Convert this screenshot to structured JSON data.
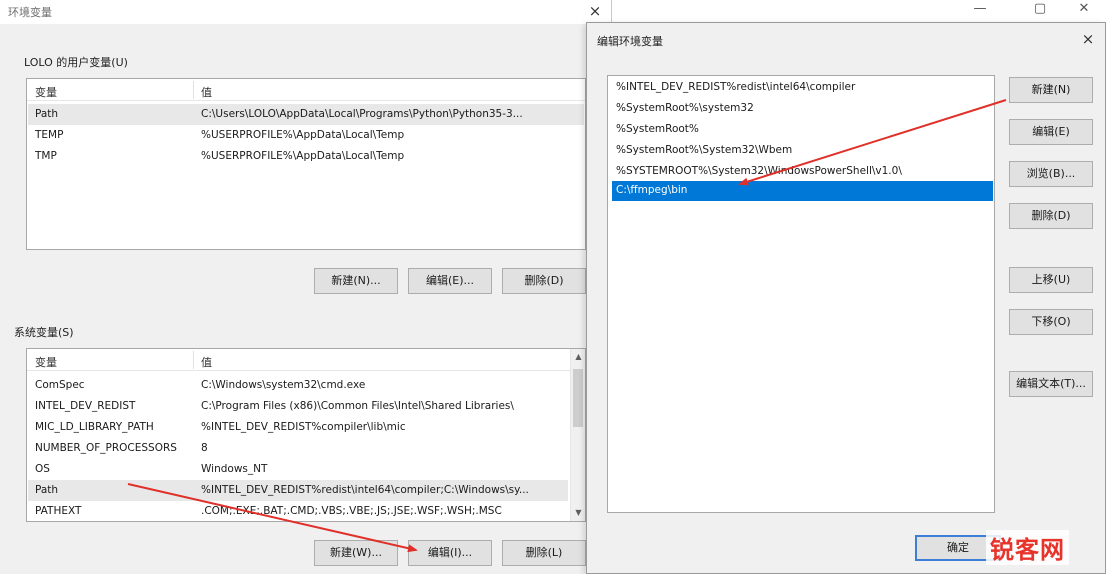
{
  "env_window": {
    "title": "环境变量",
    "close_glyph": "×",
    "user_group_label": "LOLO 的用户变量(U)",
    "user_columns": [
      "变量",
      "值"
    ],
    "user_vars": [
      {
        "name": "Path",
        "value": "C:\\Users\\LOLO\\AppData\\Local\\Programs\\Python\\Python35-3..."
      },
      {
        "name": "TEMP",
        "value": "%USERPROFILE%\\AppData\\Local\\Temp"
      },
      {
        "name": "TMP",
        "value": "%USERPROFILE%\\AppData\\Local\\Temp"
      }
    ],
    "user_buttons": {
      "new": "新建(N)...",
      "edit": "编辑(E)...",
      "delete": "删除(D)"
    },
    "system_group_label": "系统变量(S)",
    "system_columns": [
      "变量",
      "值"
    ],
    "system_vars": [
      {
        "name": "ComSpec",
        "value": "C:\\Windows\\system32\\cmd.exe"
      },
      {
        "name": "INTEL_DEV_REDIST",
        "value": "C:\\Program Files (x86)\\Common Files\\Intel\\Shared Libraries\\"
      },
      {
        "name": "MIC_LD_LIBRARY_PATH",
        "value": "%INTEL_DEV_REDIST%compiler\\lib\\mic"
      },
      {
        "name": "NUMBER_OF_PROCESSORS",
        "value": "8"
      },
      {
        "name": "OS",
        "value": "Windows_NT"
      },
      {
        "name": "Path",
        "value": "%INTEL_DEV_REDIST%redist\\intel64\\compiler;C:\\Windows\\sy..."
      },
      {
        "name": "PATHEXT",
        "value": ".COM;.EXE;.BAT;.CMD;.VBS;.VBE;.JS;.JSE;.WSF;.WSH;.MSC"
      }
    ],
    "system_buttons": {
      "new": "新建(W)...",
      "edit": "编辑(I)...",
      "delete": "删除(L)"
    },
    "scroll_up": "▲",
    "scroll_down": "▼"
  },
  "window_controls": {
    "minimize": "—",
    "maximize": "▢",
    "close": "✕"
  },
  "edit_dialog": {
    "title": "编辑环境变量",
    "close_glyph": "×",
    "paths": [
      "%INTEL_DEV_REDIST%redist\\intel64\\compiler",
      "%SystemRoot%\\system32",
      "%SystemRoot%",
      "%SystemRoot%\\System32\\Wbem",
      "%SYSTEMROOT%\\System32\\WindowsPowerShell\\v1.0\\",
      "C:\\ffmpeg\\bin"
    ],
    "selected_index": 5,
    "buttons": {
      "new": "新建(N)",
      "edit": "编辑(E)",
      "browse": "浏览(B)...",
      "delete": "删除(D)",
      "move_up": "上移(U)",
      "move_down": "下移(O)",
      "edit_text": "编辑文本(T)...",
      "ok": "确定"
    }
  },
  "annotation_color": "#e0302a",
  "watermark": "锐客网"
}
